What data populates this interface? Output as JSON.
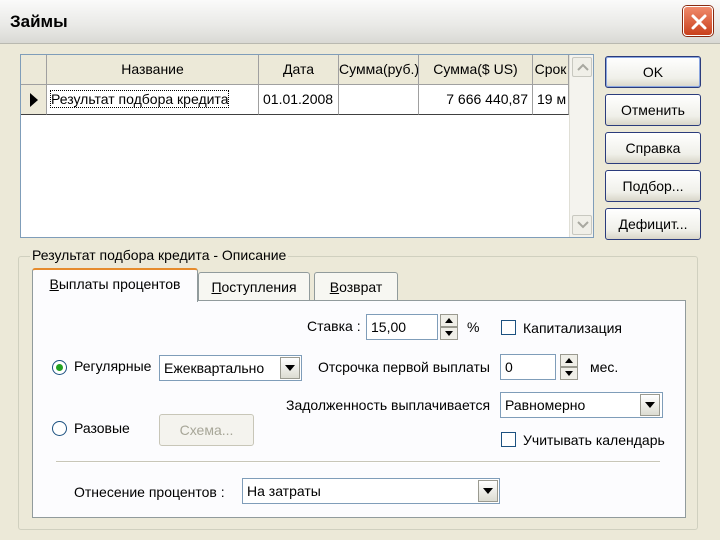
{
  "window": {
    "title": "Займы"
  },
  "grid": {
    "columns": [
      "Название",
      "Дата",
      "Сумма(руб.)",
      "Сумма($ US)",
      "Срок"
    ],
    "rows": [
      {
        "name": "Результат подбора кредита",
        "date": "01.01.2008",
        "sum_rub": "",
        "sum_usd": "7 666 440,87",
        "term": "19 м"
      }
    ]
  },
  "buttons": {
    "ok": "OK",
    "cancel": "Отменить",
    "help": "Справка",
    "selection": "Подбор...",
    "deficit": "Дефицит..."
  },
  "group": {
    "title": "Результат подбора кредита - Описание",
    "tabs": [
      {
        "label": "Выплаты процентов",
        "active": true
      },
      {
        "label": "Поступления",
        "active": false
      },
      {
        "label": "Возврат",
        "active": false
      }
    ]
  },
  "interest": {
    "rate_label": "Ставка :",
    "rate_value": "15,00",
    "rate_unit": "%",
    "capitalization_label": "Капитализация",
    "capitalization_checked": false,
    "regular_label": "Регулярные",
    "regular_checked": true,
    "regular_period": "Ежеквартально",
    "deferral_label": "Отсрочка первой выплаты",
    "deferral_value": "0",
    "deferral_unit": "мес.",
    "debt_label": "Задолженность выплачивается",
    "debt_value": "Равномерно",
    "calendar_label": "Учитывать календарь",
    "calendar_checked": false,
    "one_time_label": "Разовые",
    "one_time_checked": false,
    "scheme_button": "Схема...",
    "attribution_label": "Отнесение процентов :",
    "attribution_value": "На затраты"
  },
  "colors": {
    "active_tab_accent": "#e68b2c",
    "radio_dot": "#21a121",
    "close_button": "#c9401c"
  }
}
